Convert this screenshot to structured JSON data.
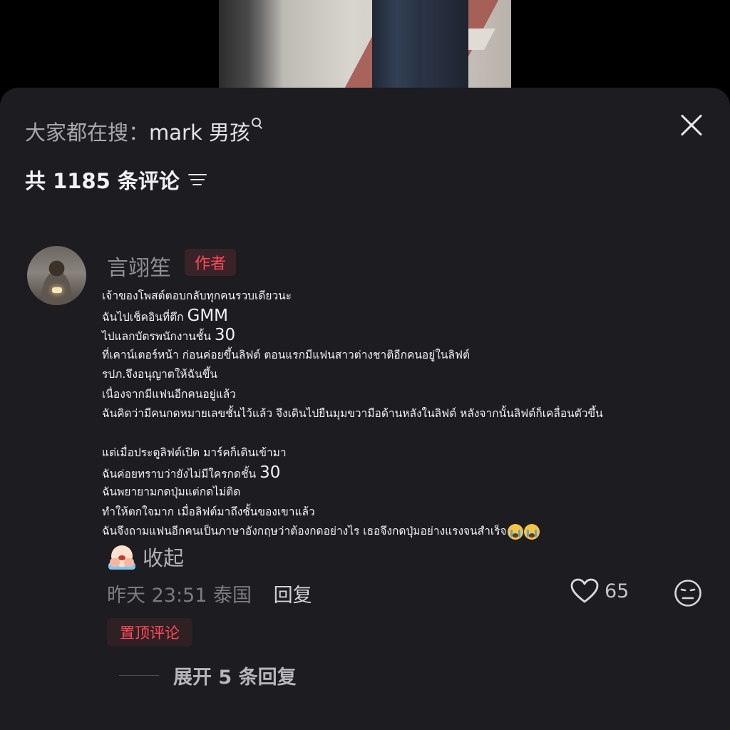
{
  "search": {
    "prefix": "大家都在搜：",
    "term": "mark 男孩"
  },
  "comments_header": {
    "count_text": "共 1185 条评论"
  },
  "comment": {
    "username": "言翊笙",
    "author_badge": "作者",
    "lines": [
      "เจ้าของโพสต์ตอบกลับทุกคนรวบเดียวนะ",
      "ฉันไปเช็คอินที่ตึก",
      "GMM",
      "ไปแลกบัตรพนักงานชั้น",
      "30",
      "ที่เคาน์เตอร์หน้า ก่อนค่อยขึ้นลิฟต์ ตอนแรกมีแฟนสาวต่างชาติอีกคนอยู่ในลิฟต์",
      "รปภ.จึงอนุญาตให้ฉันขึ้น",
      "เนื่องจากมีแฟนอีกคนอยู่แล้ว",
      "ฉันคิดว่ามีคนกดหมายเลขชั้นไว้แล้ว จึงเดินไปยืนมุมขวามือด้านหลังในลิฟต์ หลังจากนั้นลิฟต์ก็เคลื่อนตัวขึ้น",
      "แต่เมื่อประตูลิฟต์เปิด มาร์คก็เดินเข้ามา",
      "ฉันค่อยทราบว่ายังไม่มีใครกดชั้น",
      "30",
      "ฉันพยายามกดปุ่มแต่กดไม่ติด",
      "ทำให้ตกใจมาก เมื่อลิฟต์มาถึงชั้นของเขาแล้ว",
      "ฉันจึงถามแฟนอีกคนเป็นภาษาอังกฤษว่าต้องกดอย่างไร เธอจึงกดปุ่มอย่างแรงจนสำเร็จ"
    ],
    "collapse_label": "收起",
    "time": "昨天 23:51",
    "location": "泰国",
    "reply_label": "回复",
    "likes": "65",
    "pinned_badge": "置顶评论",
    "expand_replies": "展开 5 条回复"
  },
  "icons": {
    "close": "close-icon",
    "search": "search-icon",
    "sort": "sort-icon",
    "like": "heart-icon",
    "dislike": "meh-face-icon"
  },
  "colors": {
    "sheet_bg": "#1c1c21",
    "badge_red": "#ff4a5a"
  }
}
